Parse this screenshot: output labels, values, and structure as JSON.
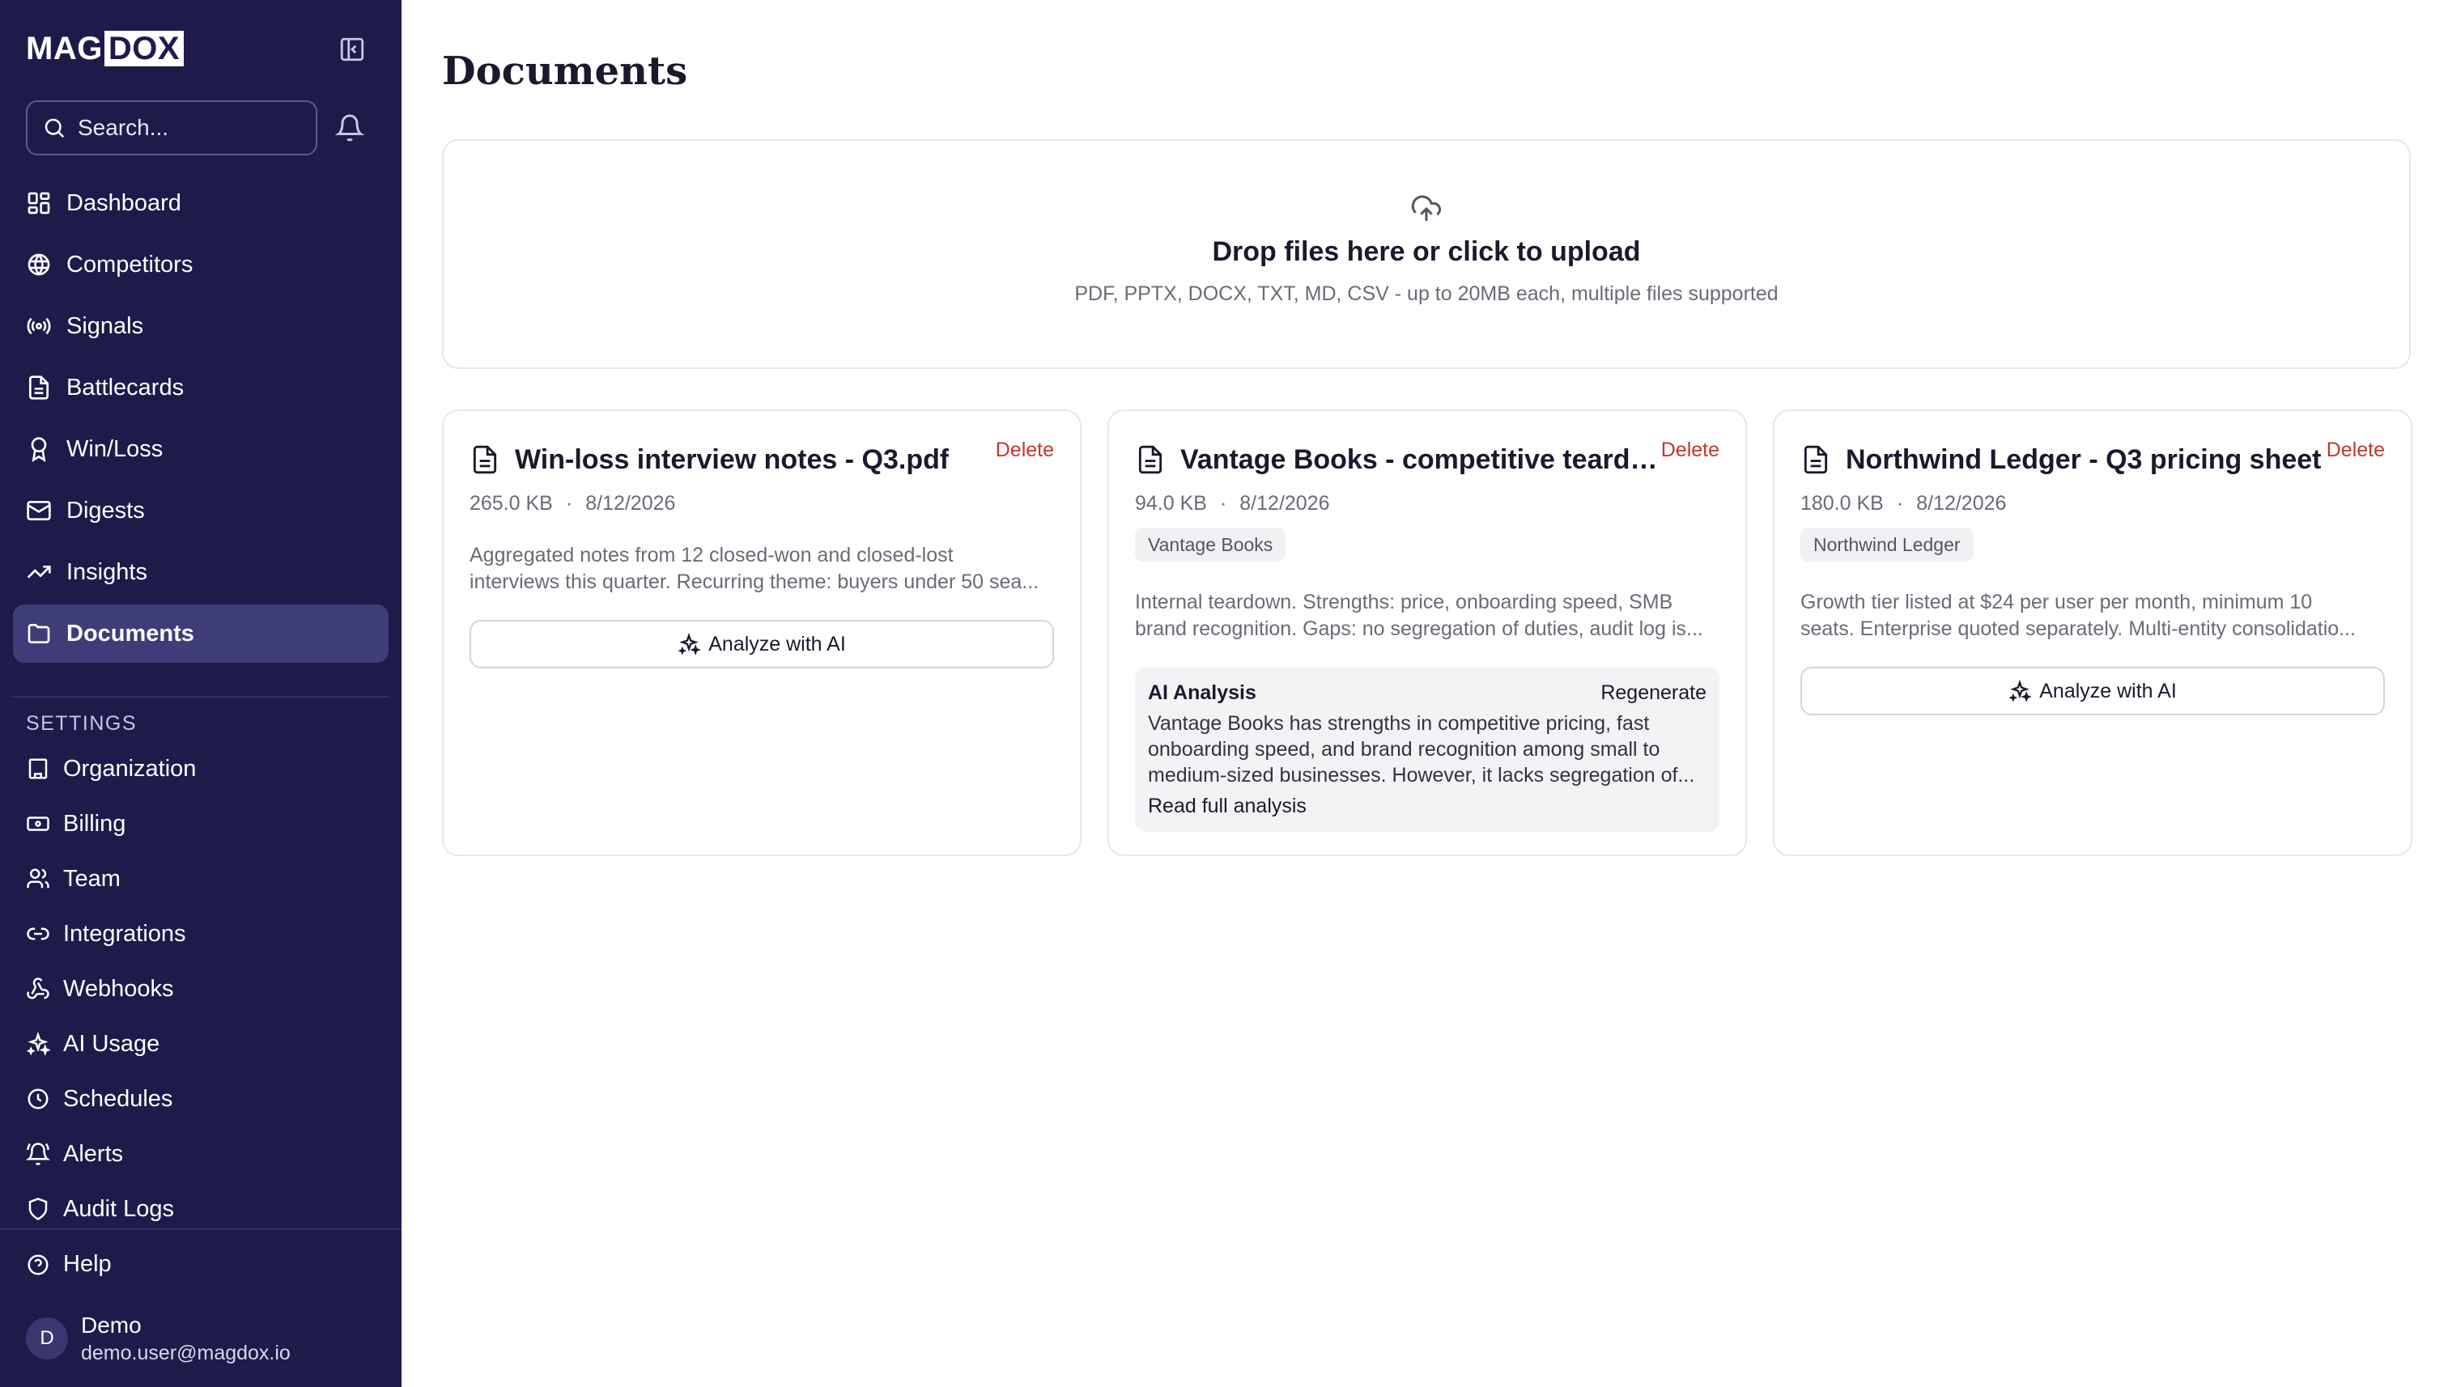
{
  "brand": {
    "part1": "MAG",
    "part2": "DOX"
  },
  "search": {
    "placeholder": "Search..."
  },
  "nav": [
    {
      "label": "Dashboard",
      "icon": "dashboard-icon"
    },
    {
      "label": "Competitors",
      "icon": "globe-icon"
    },
    {
      "label": "Signals",
      "icon": "radio-signal-icon"
    },
    {
      "label": "Battlecards",
      "icon": "file-text-icon"
    },
    {
      "label": "Win/Loss",
      "icon": "award-icon"
    },
    {
      "label": "Digests",
      "icon": "mail-icon"
    },
    {
      "label": "Insights",
      "icon": "trending-up-icon"
    },
    {
      "label": "Documents",
      "icon": "folder-icon",
      "active": true
    }
  ],
  "settings": {
    "title": "SETTINGS",
    "items": [
      {
        "label": "Organization",
        "icon": "building-icon"
      },
      {
        "label": "Billing",
        "icon": "banknote-icon"
      },
      {
        "label": "Team",
        "icon": "users-icon"
      },
      {
        "label": "Integrations",
        "icon": "link-icon"
      },
      {
        "label": "Webhooks",
        "icon": "webhook-icon"
      },
      {
        "label": "AI Usage",
        "icon": "sparkles-icon"
      },
      {
        "label": "Schedules",
        "icon": "clock-icon"
      },
      {
        "label": "Alerts",
        "icon": "bell-ring-icon"
      },
      {
        "label": "Audit Logs",
        "icon": "shield-icon"
      }
    ]
  },
  "help": {
    "label": "Help"
  },
  "user": {
    "initial": "D",
    "name": "Demo",
    "email": "demo.user@magdox.io"
  },
  "main": {
    "title": "Documents",
    "dropzone": {
      "title": "Drop files here or click to upload",
      "subtitle": "PDF, PPTX, DOCX, TXT, MD, CSV - up to 20MB each, multiple files supported"
    },
    "documents": [
      {
        "name": "Win-loss interview notes - Q3.pdf",
        "delete_label": "Delete",
        "size": "265.0 KB",
        "separator": "·",
        "date": "8/12/2026",
        "tag": "",
        "description": [
          "Aggregated notes from 12 closed-won and closed-lost",
          "interviews this quarter. Recurring theme: buyers under 50 sea..."
        ],
        "action_label": "Analyze with AI"
      },
      {
        "name": "Vantage Books - competitive teardown",
        "delete_label": "Delete",
        "size": "94.0 KB",
        "separator": "·",
        "date": "8/12/2026",
        "tag": "Vantage Books",
        "description": [
          "Internal teardown. Strengths: price, onboarding speed, SMB",
          "brand recognition. Gaps: no segregation of duties, audit log is..."
        ],
        "analysis": {
          "title": "AI Analysis",
          "regenerate_label": "Regenerate",
          "text": [
            "Vantage Books has strengths in competitive pricing, fast",
            "onboarding speed, and brand recognition among small to",
            "medium-sized businesses. However, it lacks segregation of..."
          ],
          "read_more_label": "Read full analysis"
        }
      },
      {
        "name": "Northwind Ledger - Q3 pricing sheet",
        "delete_label": "Delete",
        "size": "180.0 KB",
        "separator": "·",
        "date": "8/12/2026",
        "tag": "Northwind Ledger",
        "description": [
          "Growth tier listed at $24 per user per month, minimum 10",
          "seats. Enterprise quoted separately. Multi-entity consolidatio..."
        ],
        "action_label": "Analyze with AI"
      }
    ]
  }
}
